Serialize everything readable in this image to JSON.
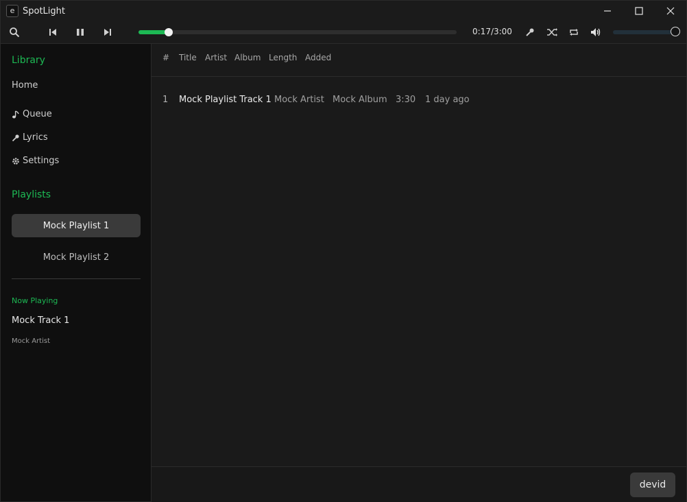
{
  "window": {
    "title": "SpotLight",
    "icon_letter": "e"
  },
  "window_controls": {
    "minimize": "—",
    "maximize": "☐",
    "close": "✕"
  },
  "player": {
    "time_text": "0:17/3:00",
    "progress_fraction": 0.094,
    "volume_fraction": 1.0,
    "accent_color": "#1db954",
    "icons": [
      "search-icon",
      "previous-icon",
      "pause-icon",
      "next-icon",
      "lyrics-mic-icon",
      "shuffle-icon",
      "repeat-icon",
      "volume-icon"
    ]
  },
  "sidebar": {
    "library_title": "Library",
    "nav": [
      {
        "label": "Home",
        "icon": ""
      },
      {
        "label": "Queue",
        "icon": "music-note-icon"
      },
      {
        "label": "Lyrics",
        "icon": "mic-icon"
      },
      {
        "label": "Settings",
        "icon": "gear-icon"
      }
    ],
    "playlists_title": "Playlists",
    "playlists": [
      {
        "label": "Mock Playlist 1",
        "active": true
      },
      {
        "label": "Mock Playlist 2",
        "active": false
      }
    ],
    "now_playing_label": "Now Playing",
    "now_playing_title": "Mock Track 1",
    "now_playing_artist": "Mock Artist"
  },
  "table": {
    "headers": [
      "#",
      "Title",
      "Artist",
      "Album",
      "Length",
      "Added"
    ],
    "rows": [
      [
        "1",
        "Mock Playlist Track 1",
        "Mock Artist",
        "Mock Album",
        "3:30",
        "1 day ago"
      ]
    ]
  },
  "footer": {
    "user_label": "devid"
  }
}
